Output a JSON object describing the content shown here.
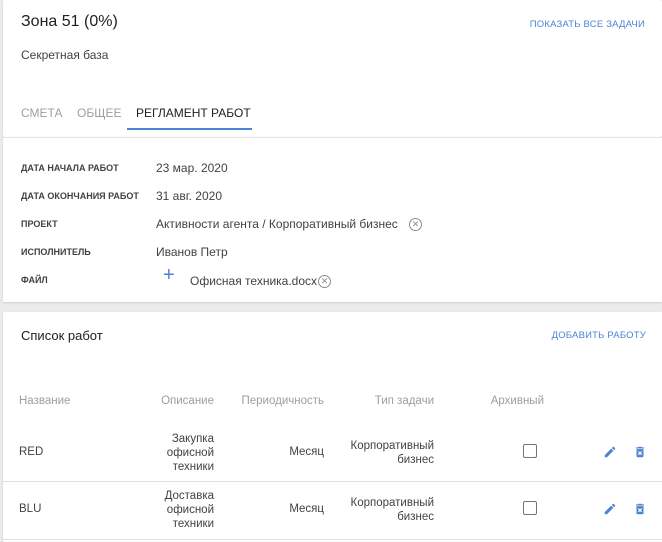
{
  "header": {
    "title": "Зона 51 (0%)",
    "subtitle": "Секретная база",
    "show_all_label": "ПОКАЗАТЬ ВСЕ ЗАДАЧИ"
  },
  "tabs": [
    {
      "label": "СМЕТА",
      "active": false
    },
    {
      "label": "ОБЩЕЕ",
      "active": false
    },
    {
      "label": "РЕГЛАМЕНТ РАБОТ",
      "active": true
    }
  ],
  "details": {
    "start_date": {
      "label": "ДАТА НАЧАЛА РАБОТ",
      "value": "23 мар. 2020"
    },
    "end_date": {
      "label": "ДАТА ОКОНЧАНИЯ РАБОТ",
      "value": "31 авг. 2020"
    },
    "project": {
      "label": "ПРОЕКТ",
      "value": "Активности агента / Корпоративный бизнес"
    },
    "assignee": {
      "label": "ИСПОЛНИТЕЛЬ",
      "value": "Иванов Петр"
    },
    "file": {
      "label": "ФАЙЛ",
      "value": "Офисная техника.docx",
      "add_icon": "plus-icon"
    }
  },
  "works": {
    "title": "Список работ",
    "add_label": "ДОБАВИТЬ РАБОТУ",
    "columns": [
      "Название",
      "Описание",
      "Периодичность",
      "Тип задачи",
      "Архивный"
    ],
    "rows": [
      {
        "name": "RED",
        "description_lines": [
          "Закупка",
          "офисной",
          "техники"
        ],
        "period": "Месяц",
        "type_lines": [
          "Корпоративный",
          "бизнес"
        ],
        "archived": false
      },
      {
        "name": "BLU",
        "description_lines": [
          "Доставка",
          "офисной",
          "техники"
        ],
        "period": "Месяц",
        "type_lines": [
          "Корпоративный",
          "бизнес"
        ],
        "archived": false
      }
    ]
  },
  "colors": {
    "accent": "#4d83d6",
    "background": "#ebebeb"
  }
}
